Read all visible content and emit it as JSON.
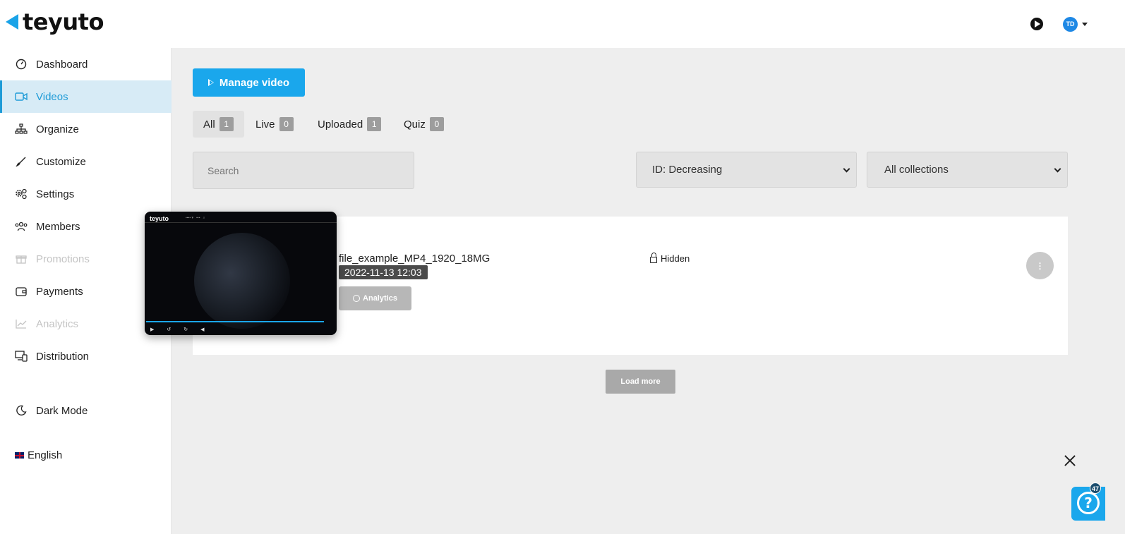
{
  "header": {
    "logo_text": "teyuto",
    "avatar_initials": "TD"
  },
  "sidebar": {
    "items": [
      {
        "label": "Dashboard",
        "icon": "gauge-icon"
      },
      {
        "label": "Videos",
        "icon": "video-camera-icon",
        "active": true
      },
      {
        "label": "Organize",
        "icon": "hierarchy-icon"
      },
      {
        "label": "Customize",
        "icon": "brush-icon"
      },
      {
        "label": "Settings",
        "icon": "gears-icon"
      },
      {
        "label": "Members",
        "icon": "users-icon"
      },
      {
        "label": "Promotions",
        "icon": "gift-icon",
        "disabled": true
      },
      {
        "label": "Payments",
        "icon": "wallet-icon"
      },
      {
        "label": "Analytics",
        "icon": "chart-line-icon",
        "disabled": true
      },
      {
        "label": "Distribution",
        "icon": "devices-icon"
      }
    ],
    "dark_mode_label": "Dark Mode",
    "language_label": "English"
  },
  "main": {
    "manage_button_label": "Manage video",
    "tabs": [
      {
        "label": "All",
        "count": "1"
      },
      {
        "label": "Live",
        "count": "0"
      },
      {
        "label": "Uploaded",
        "count": "1"
      },
      {
        "label": "Quiz",
        "count": "0"
      }
    ],
    "search_placeholder": "Search",
    "sort_selected": "ID: Decreasing",
    "collection_selected": "All collections",
    "video": {
      "title": "file_example_MP4_1920_18MG",
      "date": "2022-11-13 12:03",
      "analytics_label": "Analytics",
      "visibility": "Hidden",
      "thumbnail_logo": "teyuto"
    },
    "load_more_label": "Load more"
  },
  "help": {
    "badge_count": "47"
  },
  "colors": {
    "accent": "#1aa7ec",
    "active_bg": "#d7ebf6",
    "main_bg": "#eeeeee"
  }
}
